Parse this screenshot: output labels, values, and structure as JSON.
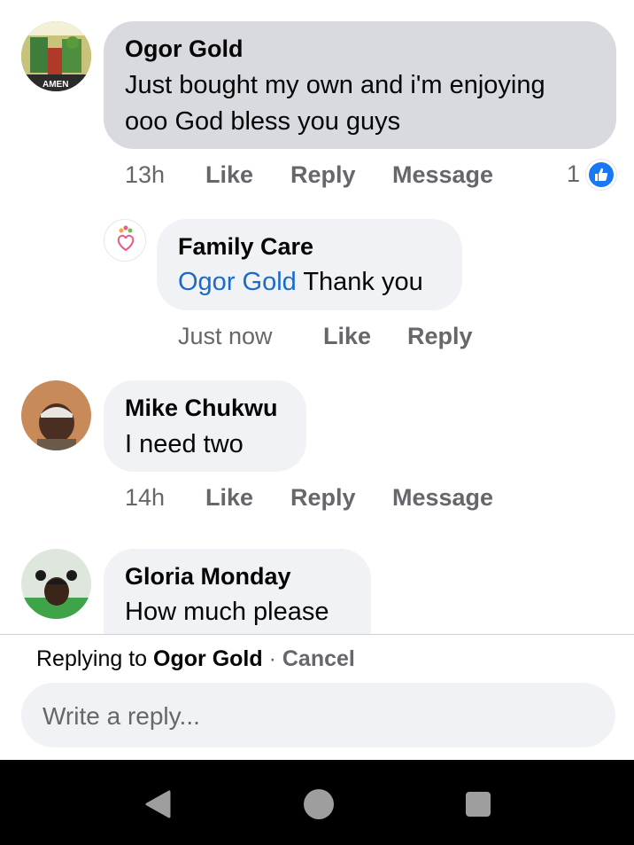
{
  "comments": [
    {
      "author": "Ogor Gold",
      "text_line1": "Just bought my own and i'm enjoying",
      "text_line2": "ooo God bless you guys",
      "avatar_caption": "AMEN",
      "time": "13h",
      "like": "Like",
      "reply": "Reply",
      "message": "Message",
      "reaction_count": "1"
    },
    {
      "author": "Family Care",
      "mention": "Ogor Gold",
      "text": " Thank you",
      "time": "Just now",
      "like": "Like",
      "reply": "Reply"
    },
    {
      "author": "Mike Chukwu",
      "text": "I need two",
      "time": "14h",
      "like": "Like",
      "reply": "Reply",
      "message": "Message"
    },
    {
      "author": "Gloria Monday",
      "text": "How much please"
    }
  ],
  "composer": {
    "replying_prefix": "Replying to ",
    "replying_to": "Ogor Gold",
    "separator": " · ",
    "cancel": "Cancel",
    "placeholder": "Write a reply..."
  },
  "colors": {
    "accent": "#1877f2",
    "mention": "#1b6ac9",
    "meta_text": "#65676b",
    "bubble": "#f0f2f5",
    "highlighted_bubble": "#d8dadf"
  },
  "icons": {
    "reaction": "thumbs-up-icon",
    "nav_back": "back-triangle-icon",
    "nav_home": "home-circle-icon",
    "nav_recents": "recents-square-icon"
  }
}
